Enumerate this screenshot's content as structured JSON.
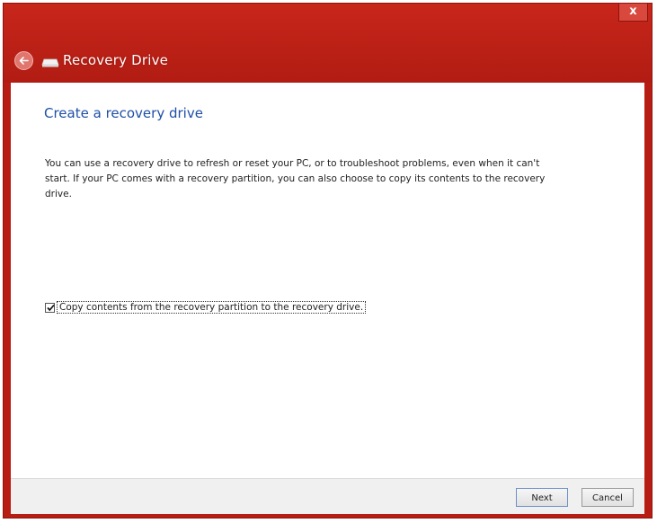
{
  "window": {
    "title": "Recovery Drive",
    "close_glyph": "x",
    "accent_color": "#b81d14"
  },
  "content": {
    "heading": "Create a recovery drive",
    "description": "You can use a recovery drive to refresh or reset your PC, or to troubleshoot problems, even when it can't start. If your PC comes with a recovery partition, you can also choose to copy its contents to the recovery drive.",
    "checkbox": {
      "label": "Copy contents from the recovery partition to the recovery drive.",
      "checked": true
    }
  },
  "footer": {
    "next_label": "Next",
    "cancel_label": "Cancel"
  },
  "icons": {
    "back": "back-arrow-icon",
    "drive": "drive-icon",
    "close": "close-icon",
    "check": "checkmark-icon"
  }
}
